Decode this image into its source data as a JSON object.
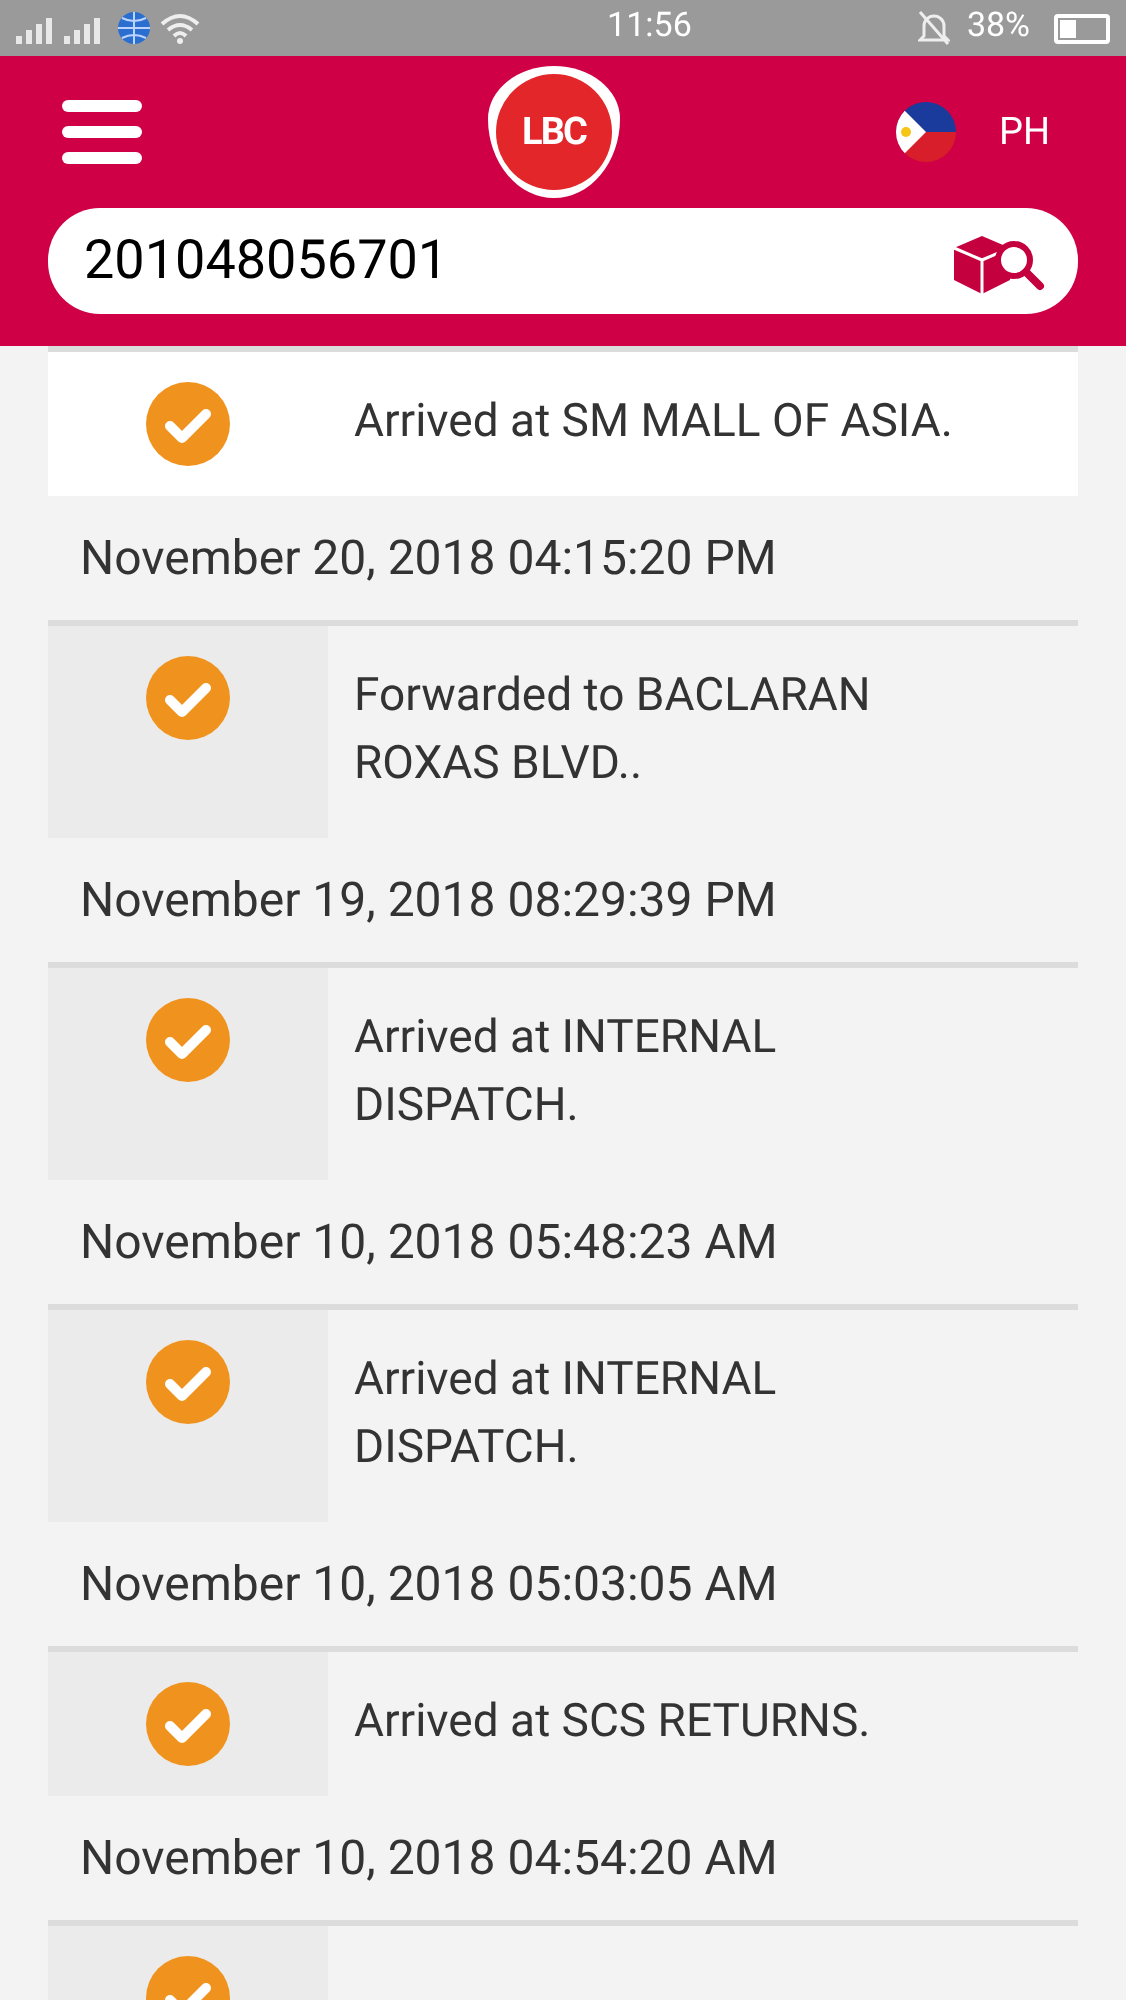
{
  "status_bar": {
    "time": "11:56",
    "battery": "38%"
  },
  "header": {
    "logo": "LBC",
    "country": "PH"
  },
  "search": {
    "value": "201048056701"
  },
  "timeline": [
    {
      "kind": "event",
      "text": "Arrived at SM MALL OF ASIA.",
      "highlighted": true
    },
    {
      "kind": "date",
      "text": "November 20, 2018 04:15:20 PM"
    },
    {
      "kind": "event",
      "text": "Forwarded to BACLARAN ROXAS BLVD..",
      "highlighted": false
    },
    {
      "kind": "date",
      "text": "November 19, 2018 08:29:39 PM"
    },
    {
      "kind": "event",
      "text": "Arrived at INTERNAL DISPATCH.",
      "highlighted": false
    },
    {
      "kind": "date",
      "text": "November 10, 2018 05:48:23 AM"
    },
    {
      "kind": "event",
      "text": "Arrived at INTERNAL DISPATCH.",
      "highlighted": false
    },
    {
      "kind": "date",
      "text": "November 10, 2018 05:03:05 AM"
    },
    {
      "kind": "event",
      "text": "Arrived at SCS RETURNS.",
      "highlighted": false
    },
    {
      "kind": "date",
      "text": "November 10, 2018 04:54:20 AM"
    },
    {
      "kind": "event",
      "highlighted": false
    }
  ]
}
